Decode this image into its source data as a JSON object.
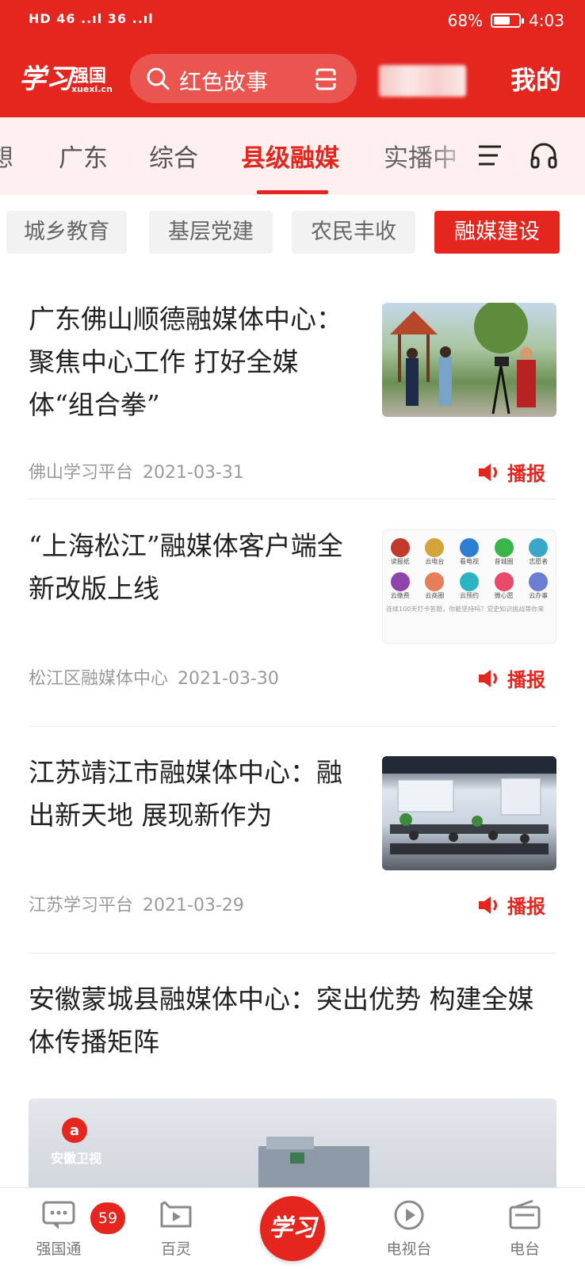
{
  "status": {
    "left": "HD 46 ..ıl 36 ..ıl",
    "battery": "68%",
    "battery_level": 0.68,
    "time": "4:03"
  },
  "header": {
    "logo_big": "学习",
    "logo_small": "强国",
    "logo_url": "xuexi.cn",
    "search_text": "红色故事",
    "mine_label": "我的"
  },
  "tabs": [
    {
      "label": "想",
      "active": false
    },
    {
      "label": "广东",
      "active": false
    },
    {
      "label": "综合",
      "active": false
    },
    {
      "label": "县级融媒",
      "active": true
    },
    {
      "label": "实播中",
      "active": false
    }
  ],
  "chips": [
    "城乡教育",
    "基层党建",
    "农民丰收",
    "融媒建设"
  ],
  "active_chip": "融媒建设",
  "articles": [
    {
      "title": "广东佛山顺德融媒体中心：聚焦中心工作 打好全媒体“组合拳”",
      "source": "佛山学习平台",
      "date": "2021-03-31",
      "action": "播报"
    },
    {
      "title": "“上海松江”融媒体客户端全新改版上线",
      "source": "松江区融媒体中心",
      "date": "2021-03-30",
      "action": "播报"
    },
    {
      "title": "江苏靖江市融媒体中心：融出新天地 展现新作为",
      "source": "江苏学习平台",
      "date": "2021-03-29",
      "action": "播报"
    },
    {
      "title": "安徽蒙城县融媒体中心：突出优势  构建全媒体传播矩阵"
    }
  ],
  "thumb2_grid": [
    [
      "读报纸",
      "云电台",
      "看电视",
      "昔城圈",
      "志愿者"
    ],
    [
      "云缴费",
      "云商圈",
      "云预约",
      "微心愿",
      "云办事"
    ]
  ],
  "thumb2_caption": "连续100天打卡答题，你能坚持吗？党史知识挑战等你来",
  "big_image_logo": "安徽卫视",
  "bottom_nav": [
    {
      "label": "强国通",
      "badge": "59"
    },
    {
      "label": "百灵"
    },
    {
      "label": "学习"
    },
    {
      "label": "电视台"
    },
    {
      "label": "电台"
    }
  ]
}
